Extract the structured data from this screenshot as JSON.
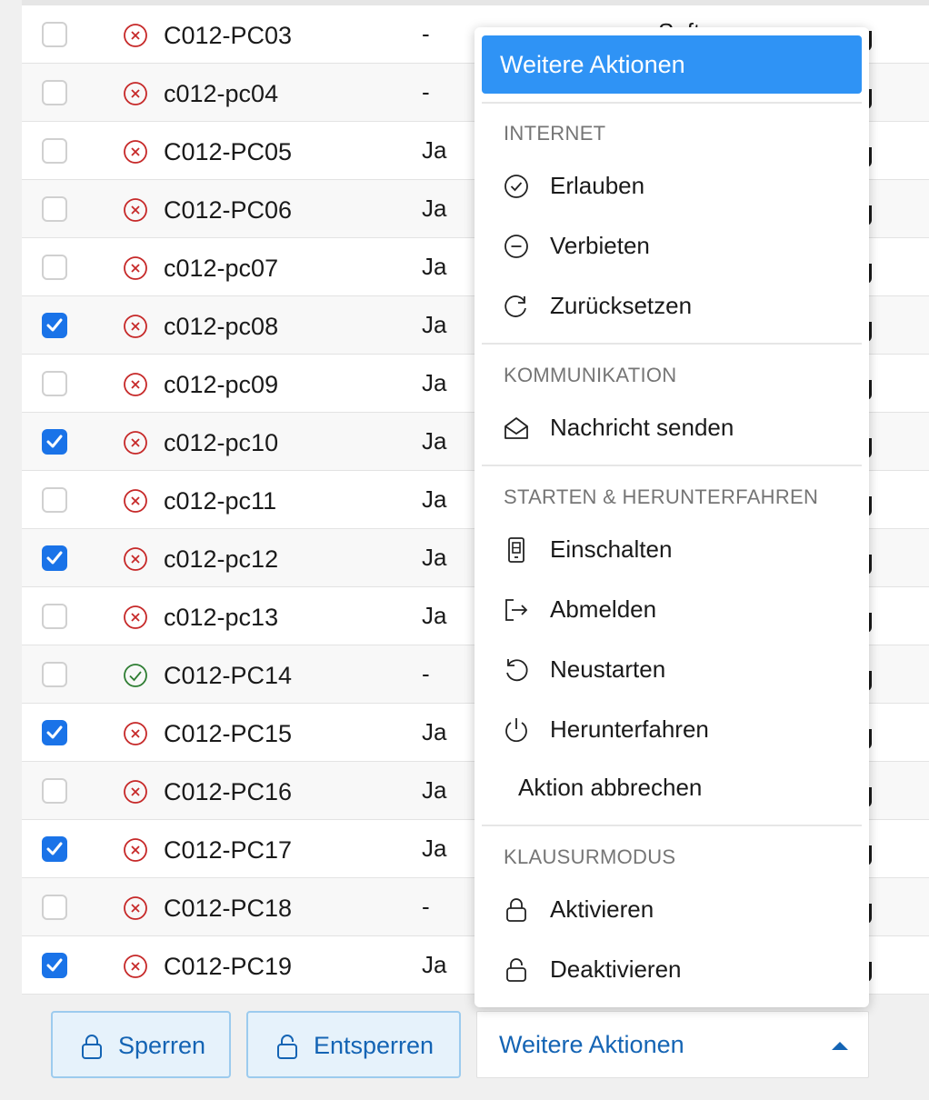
{
  "colors": {
    "accent": "#2f93f5",
    "checkbox_checked": "#1a73e8",
    "error_red": "#c62828",
    "ok_green": "#2e7d32",
    "link_blue": "#1464b4"
  },
  "table": {
    "partial_column_text": "Software",
    "rows": [
      {
        "name": "C012-PC03",
        "col": "-",
        "checked": false,
        "status": "error"
      },
      {
        "name": "c012-pc04",
        "col": "-",
        "checked": false,
        "status": "error"
      },
      {
        "name": "C012-PC05",
        "col": "Ja",
        "checked": false,
        "status": "error"
      },
      {
        "name": "C012-PC06",
        "col": "Ja",
        "checked": false,
        "status": "error"
      },
      {
        "name": "c012-pc07",
        "col": "Ja",
        "checked": false,
        "status": "error"
      },
      {
        "name": "c012-pc08",
        "col": "Ja",
        "checked": true,
        "status": "error"
      },
      {
        "name": "c012-pc09",
        "col": "Ja",
        "checked": false,
        "status": "error"
      },
      {
        "name": "c012-pc10",
        "col": "Ja",
        "checked": true,
        "status": "error"
      },
      {
        "name": "c012-pc11",
        "col": "Ja",
        "checked": false,
        "status": "error"
      },
      {
        "name": "c012-pc12",
        "col": "Ja",
        "checked": true,
        "status": "error"
      },
      {
        "name": "c012-pc13",
        "col": "Ja",
        "checked": false,
        "status": "error"
      },
      {
        "name": "C012-PC14",
        "col": "-",
        "checked": false,
        "status": "ok"
      },
      {
        "name": "C012-PC15",
        "col": "Ja",
        "checked": true,
        "status": "error"
      },
      {
        "name": "C012-PC16",
        "col": "Ja",
        "checked": false,
        "status": "error"
      },
      {
        "name": "C012-PC17",
        "col": "Ja",
        "checked": true,
        "status": "error"
      },
      {
        "name": "C012-PC18",
        "col": "-",
        "checked": false,
        "status": "error"
      },
      {
        "name": "C012-PC19",
        "col": "Ja",
        "checked": true,
        "status": "error"
      }
    ]
  },
  "footer": {
    "lock_label": "Sperren",
    "unlock_label": "Entsperren",
    "more_label": "Weitere Aktionen"
  },
  "dropdown": {
    "header": "Weitere Aktionen",
    "sections": [
      {
        "title": "INTERNET",
        "items": [
          {
            "label": "Erlauben",
            "icon": "check-circle-icon"
          },
          {
            "label": "Verbieten",
            "icon": "minus-circle-icon"
          },
          {
            "label": "Zurücksetzen",
            "icon": "refresh-icon"
          }
        ]
      },
      {
        "title": "KOMMUNIKATION",
        "items": [
          {
            "label": "Nachricht senden",
            "icon": "envelope-open-icon"
          }
        ]
      },
      {
        "title": "STARTEN & HERUNTERFAHREN",
        "items": [
          {
            "label": "Einschalten",
            "icon": "computer-tower-icon"
          },
          {
            "label": "Abmelden",
            "icon": "logout-icon"
          },
          {
            "label": "Neustarten",
            "icon": "restart-icon"
          },
          {
            "label": "Herunterfahren",
            "icon": "power-icon"
          },
          {
            "label": "Aktion abbrechen",
            "icon": ""
          }
        ]
      },
      {
        "title": "KLAUSURMODUS",
        "items": [
          {
            "label": "Aktivieren",
            "icon": "lock-icon"
          },
          {
            "label": "Deaktivieren",
            "icon": "unlock-icon"
          }
        ]
      }
    ]
  }
}
